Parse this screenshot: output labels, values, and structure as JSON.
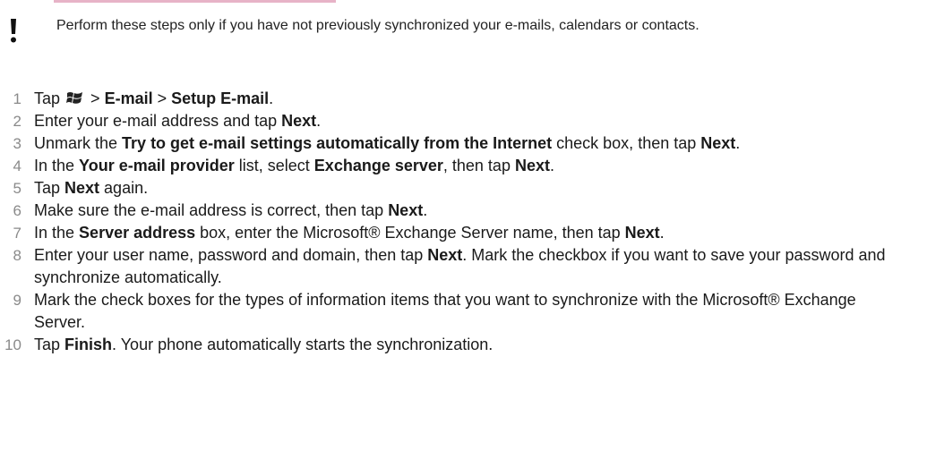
{
  "note": {
    "icon": "exclamation-icon",
    "text": "Perform these steps only if you have not previously synchronized your e-mails, calendars or contacts."
  },
  "steps": [
    {
      "number": "1",
      "parts": [
        {
          "t": "Tap ",
          "b": false
        },
        {
          "icon": "windows-start-icon"
        },
        {
          "t": " > ",
          "b": false
        },
        {
          "t": "E-mail",
          "b": true
        },
        {
          "t": " > ",
          "b": false
        },
        {
          "t": "Setup E-mail",
          "b": true
        },
        {
          "t": ".",
          "b": false
        }
      ]
    },
    {
      "number": "2",
      "parts": [
        {
          "t": "Enter your e-mail address and tap ",
          "b": false
        },
        {
          "t": "Next",
          "b": true
        },
        {
          "t": ".",
          "b": false
        }
      ]
    },
    {
      "number": "3",
      "parts": [
        {
          "t": "Unmark the ",
          "b": false
        },
        {
          "t": "Try to get e-mail settings automatically from the Internet",
          "b": true
        },
        {
          "t": " check box, then tap ",
          "b": false
        },
        {
          "t": "Next",
          "b": true
        },
        {
          "t": ".",
          "b": false
        }
      ]
    },
    {
      "number": "4",
      "parts": [
        {
          "t": "In the ",
          "b": false
        },
        {
          "t": "Your e-mail provider",
          "b": true
        },
        {
          "t": " list, select ",
          "b": false
        },
        {
          "t": "Exchange server",
          "b": true
        },
        {
          "t": ", then tap ",
          "b": false
        },
        {
          "t": "Next",
          "b": true
        },
        {
          "t": ".",
          "b": false
        }
      ]
    },
    {
      "number": "5",
      "parts": [
        {
          "t": "Tap ",
          "b": false
        },
        {
          "t": "Next",
          "b": true
        },
        {
          "t": " again.",
          "b": false
        }
      ]
    },
    {
      "number": "6",
      "parts": [
        {
          "t": "Make sure the e-mail address is correct, then tap ",
          "b": false
        },
        {
          "t": "Next",
          "b": true
        },
        {
          "t": ".",
          "b": false
        }
      ]
    },
    {
      "number": "7",
      "parts": [
        {
          "t": "In the ",
          "b": false
        },
        {
          "t": "Server address",
          "b": true
        },
        {
          "t": " box, enter the Microsoft® Exchange Server name, then tap ",
          "b": false
        },
        {
          "t": "Next",
          "b": true
        },
        {
          "t": ".",
          "b": false
        }
      ]
    },
    {
      "number": "8",
      "parts": [
        {
          "t": "Enter your user name, password and domain, then tap ",
          "b": false
        },
        {
          "t": "Next",
          "b": true
        },
        {
          "t": ". Mark the checkbox if you want to save your password and synchronize automatically.",
          "b": false
        }
      ]
    },
    {
      "number": "9",
      "parts": [
        {
          "t": "Mark the check boxes for the types of information items that you want to synchronize with the Microsoft® Exchange Server.",
          "b": false
        }
      ]
    },
    {
      "number": "10",
      "parts": [
        {
          "t": "Tap ",
          "b": false
        },
        {
          "t": "Finish",
          "b": true
        },
        {
          "t": ". Your phone automatically starts the synchronization.",
          "b": false
        }
      ]
    }
  ]
}
